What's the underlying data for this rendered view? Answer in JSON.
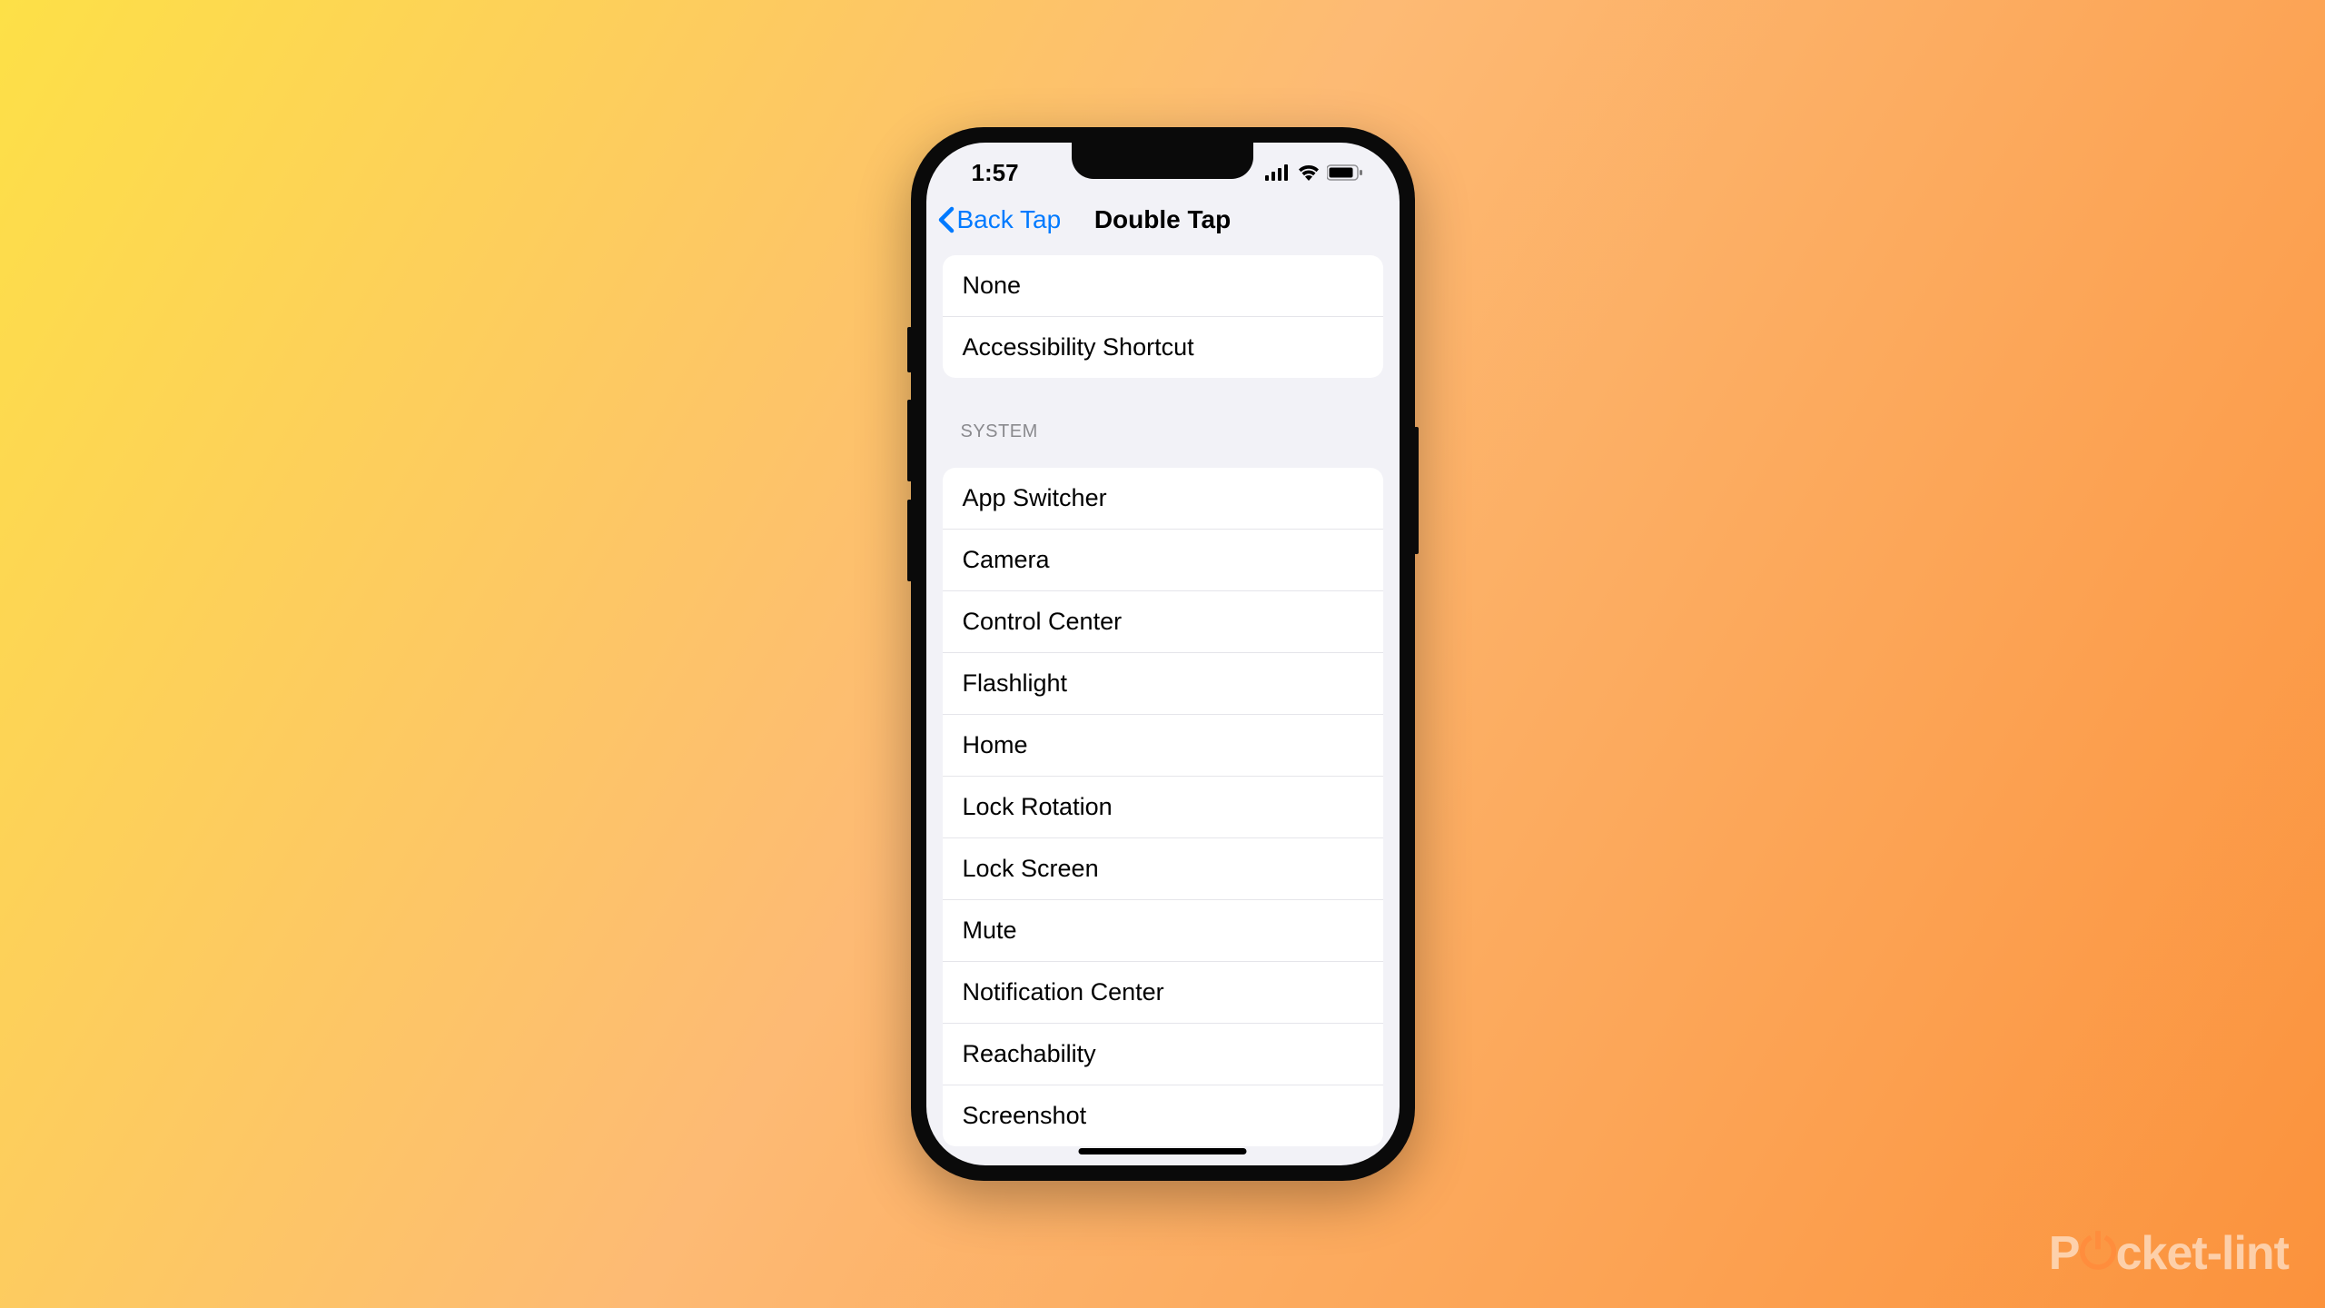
{
  "status_bar": {
    "time": "1:57"
  },
  "nav": {
    "back_label": "Back Tap",
    "title": "Double Tap"
  },
  "groups": [
    {
      "header": null,
      "items": [
        "None",
        "Accessibility Shortcut"
      ]
    },
    {
      "header": "SYSTEM",
      "items": [
        "App Switcher",
        "Camera",
        "Control Center",
        "Flashlight",
        "Home",
        "Lock Rotation",
        "Lock Screen",
        "Mute",
        "Notification Center",
        "Reachability",
        "Screenshot"
      ]
    }
  ],
  "watermark": {
    "prefix": "P",
    "o": "o",
    "suffix": "cket-lint"
  }
}
